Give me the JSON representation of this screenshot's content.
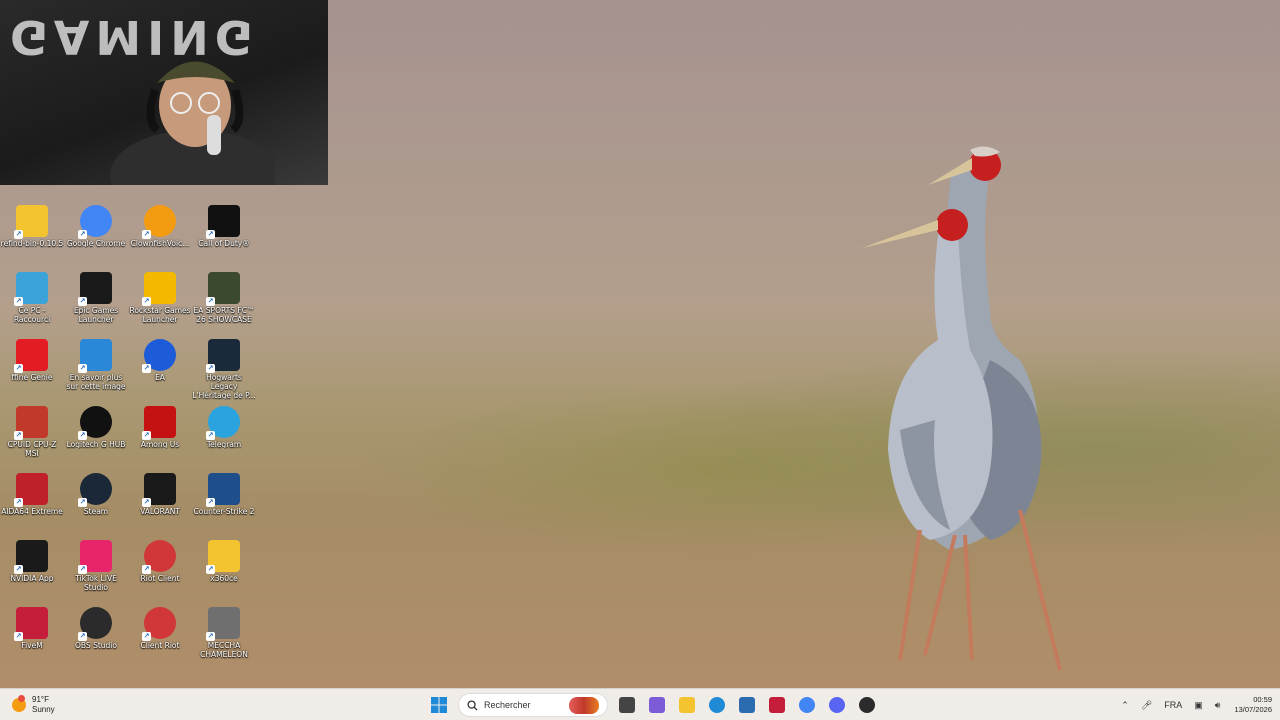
{
  "webcam": {
    "sign_text": "GAMING"
  },
  "desktop": {
    "icons": [
      {
        "label": "refind-bin-0.10.5",
        "icon": "folder-icon",
        "color": "#f4c430"
      },
      {
        "label": "Google Chrome",
        "icon": "chrome-icon",
        "color": "#4285f4"
      },
      {
        "label": "ClownfishVoic...",
        "icon": "clownfish-icon",
        "color": "#f39c12"
      },
      {
        "label": "Call of Duty®",
        "icon": "call-of-duty-icon",
        "color": "#111111"
      },
      {
        "label": "Ce PC - Raccourci",
        "icon": "computer-icon",
        "color": "#3ba3d9"
      },
      {
        "label": "Epic Games Launcher",
        "icon": "epic-games-icon",
        "color": "#1a1a1a"
      },
      {
        "label": "Rockstar Games Launcher",
        "icon": "rockstar-icon",
        "color": "#f5b800"
      },
      {
        "label": "EA SPORTS FC™ 26 SHOWCASE",
        "icon": "ea-fc-icon",
        "color": "#3b4a2f"
      },
      {
        "label": "ffine Genie",
        "icon": "fifine-icon",
        "color": "#e31b23"
      },
      {
        "label": "En savoir plus sur cette image",
        "icon": "info-icon",
        "color": "#2b88d8"
      },
      {
        "label": "EA",
        "icon": "ea-icon",
        "color": "#1e5bd8"
      },
      {
        "label": "Hogwarts Legacy L'Héritage de P...",
        "icon": "hogwarts-icon",
        "color": "#1b2a3a"
      },
      {
        "label": "CPUID CPU-Z MSI",
        "icon": "cpuz-icon",
        "color": "#c0392b"
      },
      {
        "label": "Logitech G HUB",
        "icon": "logitech-icon",
        "color": "#111111"
      },
      {
        "label": "Among Us",
        "icon": "among-us-icon",
        "color": "#c51111"
      },
      {
        "label": "Telegram",
        "icon": "telegram-icon",
        "color": "#2aa3df"
      },
      {
        "label": "AIDA64 Extreme",
        "icon": "aida64-icon",
        "color": "#c0202a"
      },
      {
        "label": "Steam",
        "icon": "steam-icon",
        "color": "#1b2838"
      },
      {
        "label": "VALORANT",
        "icon": "valorant-icon",
        "color": "#1a1a1a"
      },
      {
        "label": "Counter-Strike 2",
        "icon": "counter-strike-icon",
        "color": "#1f4f8a"
      },
      {
        "label": "NVIDIA App",
        "icon": "nvidia-icon",
        "color": "#1a1a1a"
      },
      {
        "label": "TikTok LIVE Studio",
        "icon": "tiktok-icon",
        "color": "#e8256b"
      },
      {
        "label": "Riot Client",
        "icon": "riot-icon",
        "color": "#d13639"
      },
      {
        "label": "x360ce",
        "icon": "folder-icon",
        "color": "#f4c430"
      },
      {
        "label": "FiveM",
        "icon": "fivem-icon",
        "color": "#c41e3a"
      },
      {
        "label": "OBS Studio",
        "icon": "obs-icon",
        "color": "#2b2b2b"
      },
      {
        "label": "Client Riot",
        "icon": "riot-icon",
        "color": "#d13639"
      },
      {
        "label": "MECCHA CHAMELEON",
        "icon": "meccha-icon",
        "color": "#6f6f6f"
      }
    ]
  },
  "taskbar": {
    "weather": {
      "temp": "91°F",
      "condition": "Sunny"
    },
    "search_placeholder": "Rechercher",
    "pinned": [
      {
        "icon": "task-view-icon",
        "color": "#444444"
      },
      {
        "icon": "copilot-icon",
        "color": "#7b5cd6"
      },
      {
        "icon": "file-explorer-icon",
        "color": "#f4c430"
      },
      {
        "icon": "edge-icon",
        "color": "#1f8ad6"
      },
      {
        "icon": "store-icon",
        "color": "#2b6cb0"
      },
      {
        "icon": "acrobat-icon",
        "color": "#c41e3a"
      },
      {
        "icon": "chrome-icon",
        "color": "#4285f4"
      },
      {
        "icon": "discord-icon",
        "color": "#5865f2"
      },
      {
        "icon": "obs-icon",
        "color": "#2b2b2b"
      }
    ],
    "tray": {
      "language": "FRA",
      "time": "00:59",
      "date": "13/07/2026"
    }
  }
}
